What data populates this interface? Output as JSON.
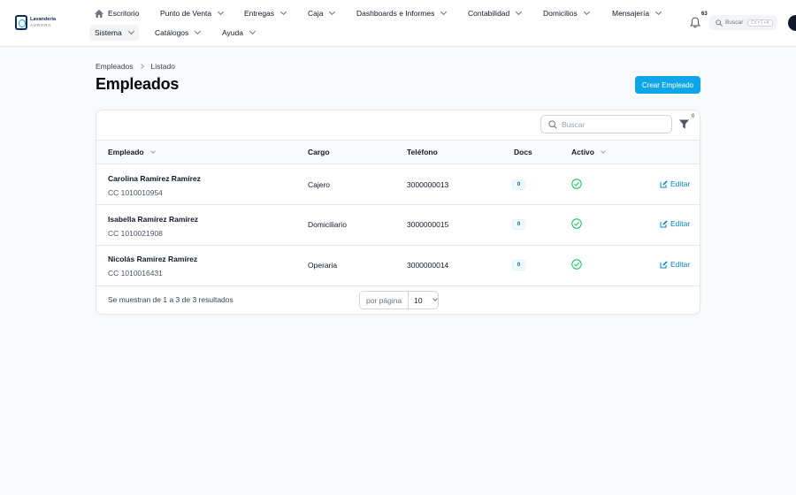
{
  "brand": {
    "line1": "Lavandería",
    "line2": "AURORA"
  },
  "nav": {
    "row1": [
      {
        "label": "Escritorio",
        "icon": "home-icon"
      },
      {
        "label": "Punto de Venta"
      },
      {
        "label": "Entregas"
      },
      {
        "label": "Caja"
      },
      {
        "label": "Dashboards e Informes"
      },
      {
        "label": "Contabilidad"
      },
      {
        "label": "Domicilios"
      },
      {
        "label": "Mensajería"
      }
    ],
    "row2": [
      {
        "label": "Sistema",
        "active": true
      },
      {
        "label": "Catálogos"
      },
      {
        "label": "Ayuda"
      }
    ]
  },
  "notifications": {
    "count": "63",
    "icon": "bell-icon"
  },
  "global_search": {
    "label": "Buscar",
    "shortcut": "Ctrl+K"
  },
  "breadcrumb": [
    "Empleados",
    "Listado"
  ],
  "page_title": "Empleados",
  "create_button": "Crear Empleado",
  "table": {
    "search_placeholder": "Buscar",
    "filter_count": "0",
    "headers": {
      "employee": "Empleado",
      "role": "Cargo",
      "phone": "Teléfono",
      "docs": "Docs",
      "active": "Activo"
    },
    "rows": [
      {
        "name": "Carolina Ramírez Ramírez",
        "doc": "CC 1010010954",
        "role": "Cajero",
        "phone": "3000000013",
        "docs": "0",
        "active": true,
        "action": "Editar"
      },
      {
        "name": "Isabella Ramírez Ramírez",
        "doc": "CC 1010021908",
        "role": "Domiciliario",
        "phone": "3000000015",
        "docs": "0",
        "active": true,
        "action": "Editar"
      },
      {
        "name": "Nicolás Ramírez Ramírez",
        "doc": "CC 1010016431",
        "role": "Operaria",
        "phone": "3000000014",
        "docs": "0",
        "active": true,
        "action": "Editar"
      }
    ],
    "footer": "Se muestran de 1 a 3 de 3 resultados",
    "per_page_label": "por página",
    "per_page_value": "10"
  },
  "colors": {
    "accent": "#0ea5e9",
    "link": "#0284c7",
    "success": "#22c55e"
  }
}
